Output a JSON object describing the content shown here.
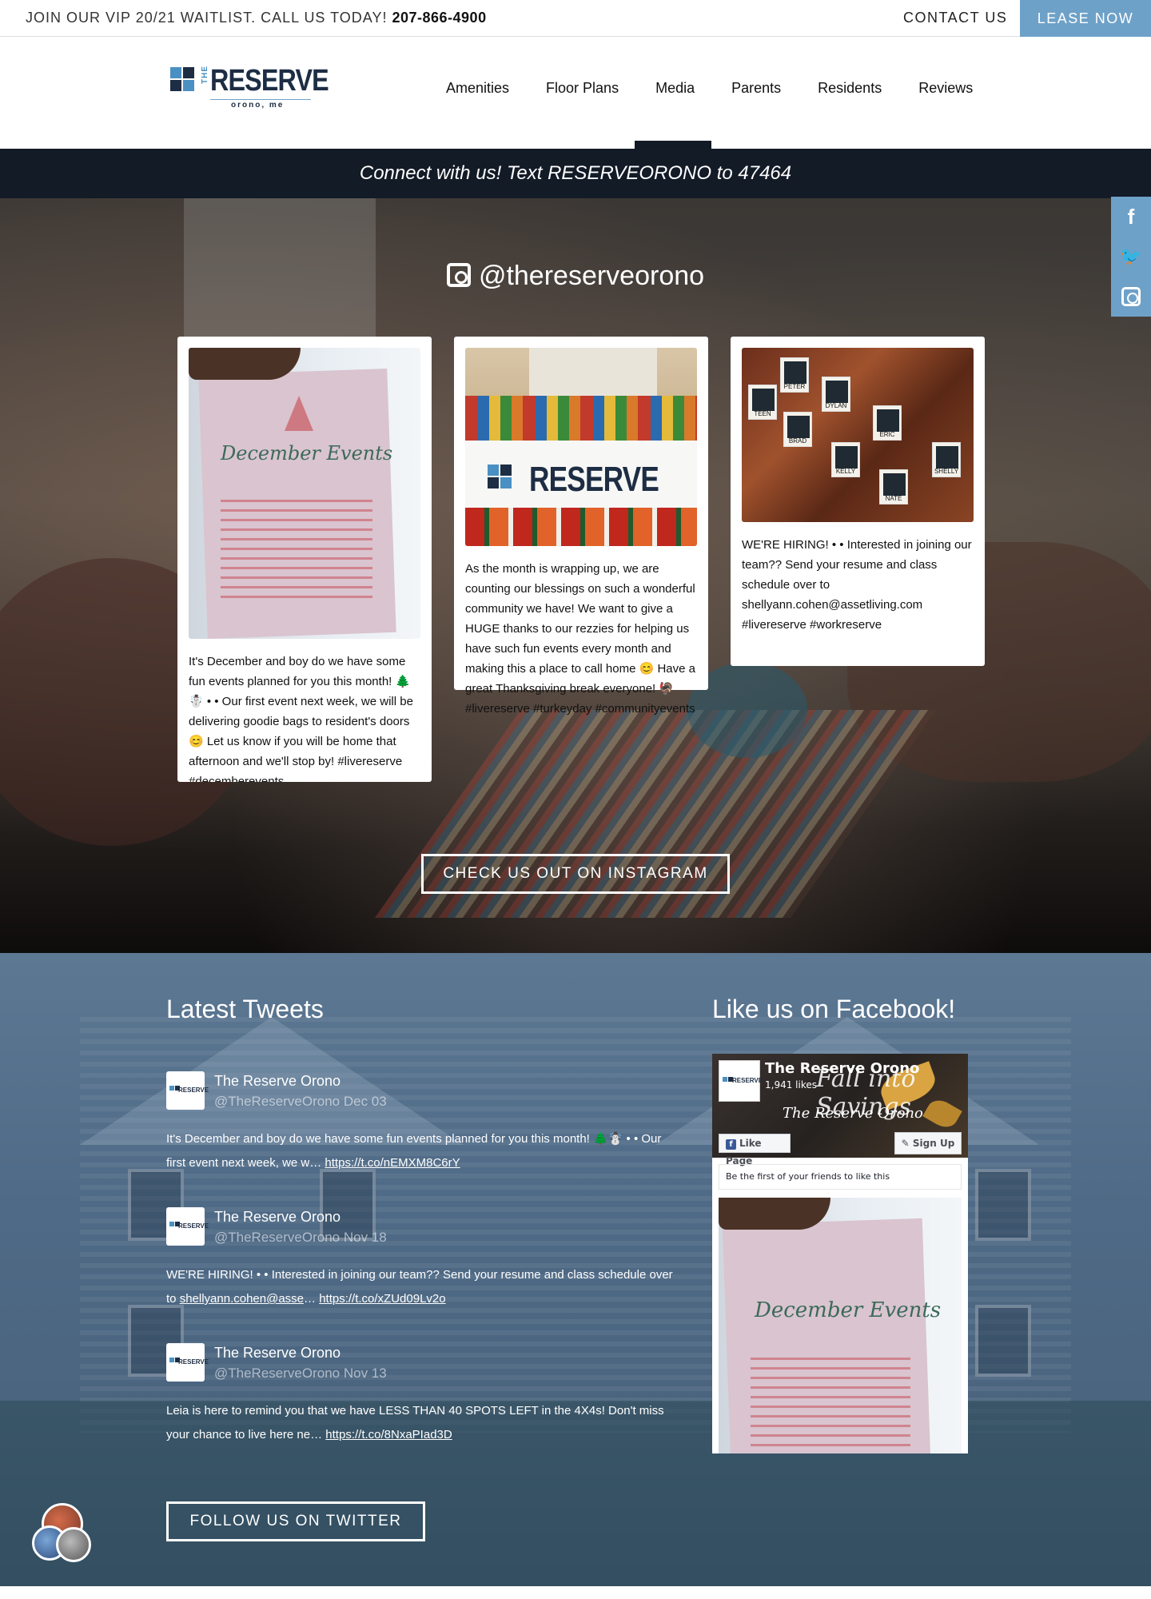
{
  "topbar": {
    "vip_text": "JOIN OUR VIP 20/21 WAITLIST. CALL US TODAY!",
    "phone": "207-866-4900",
    "contact_label": "CONTACT US",
    "lease_label": "LEASE NOW"
  },
  "logo": {
    "the": "THE",
    "wordmark": "RESERVE",
    "location": "orono, me"
  },
  "nav": {
    "items": [
      "Amenities",
      "Floor Plans",
      "Media",
      "Parents",
      "Residents",
      "Reviews"
    ],
    "active": "Media"
  },
  "connect_banner": "Connect with us! Text RESERVEORONO to 47464",
  "instagram": {
    "handle": "@thereserveorono",
    "posts": [
      {
        "photo_text": "December Events",
        "caption": "It's December and boy do we have some fun events planned for you this month! 🌲☃️ • • Our first event next week, we will be delivering goodie bags to resident's doors 😊 Let us know if you will be home that afternoon and we'll stop by! #livereserve #decemberevents"
      },
      {
        "photo_text": "RESERVE",
        "caption": "As the month is wrapping up, we are counting our blessings on such a wonderful community we have! We want to give a HUGE thanks to our rezzies for helping us have such fun events every month and making this a place to call home 😊 Have a great Thanksgiving break everyone! 🦃 #livereserve #turkeyday #communityevents"
      },
      {
        "photo_labels": [
          "TEEN",
          "PETER",
          "DYLAN",
          "BRAD",
          "ERIC",
          "KELLY",
          "NATE",
          "SHELLY"
        ],
        "caption": "WE'RE HIRING! • • Interested in joining our team?? Send your resume and class schedule over to shellyann.cohen@assetliving.com #livereserve #workreserve"
      }
    ],
    "button_label": "CHECK US OUT ON INSTAGRAM"
  },
  "social_bar": {
    "icons": [
      "facebook-icon",
      "twitter-icon",
      "instagram-icon"
    ],
    "facebook_glyph": "f",
    "twitter_glyph": "🐦"
  },
  "tweets": {
    "title": "Latest Tweets",
    "items": [
      {
        "name": "The Reserve Orono",
        "handle": "@TheReserveOrono",
        "date": "Dec 03",
        "text": "It's December and boy do we have some fun events planned for you this month! 🌲☃️ • • Our first event next week, we w…",
        "link": "https://t.co/nEMXM8C6rY"
      },
      {
        "name": "The Reserve Orono",
        "handle": "@TheReserveOrono",
        "date": "Nov 18",
        "text": "WE'RE HIRING! • • Interested in joining our team?? Send your resume and class schedule over to",
        "mention": "shellyann.cohen@asse",
        "text_after": "…",
        "link": "https://t.co/xZUd09Lv2o"
      },
      {
        "name": "The Reserve Orono",
        "handle": "@TheReserveOrono",
        "date": "Nov 13",
        "text": "Leia is here to remind you that we have LESS THAN 40 SPOTS LEFT in the 4X4s! Don't miss your chance to live here ne…",
        "link": "https://t.co/8NxaPIad3D"
      }
    ],
    "button_label": "FOLLOW US ON TWITTER"
  },
  "facebook": {
    "title": "Like us on Facebook!",
    "page_name": "The Reserve Orono",
    "likes": "1,941 likes",
    "cover_text": "Fall into Savings",
    "cover_script": "The Reserve Orono",
    "like_button": "Like Page",
    "signup_button": "Sign Up",
    "friends_text": "Be the first of your friends to like this",
    "post_text": "December Events"
  },
  "colors": {
    "accent": "#6ea1c8",
    "dark_navy": "#131b27",
    "tweets_bg": "#4f6a86"
  }
}
